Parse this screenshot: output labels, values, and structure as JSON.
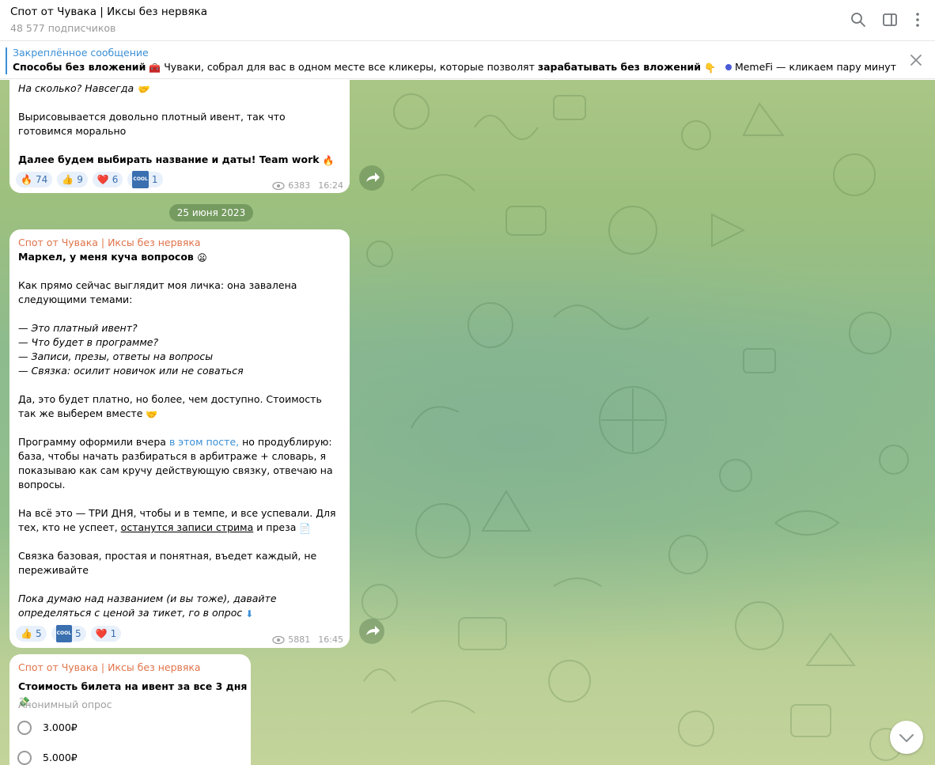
{
  "header": {
    "title": "Спот от Чувака | Иксы без нервяка",
    "subscribers": "48 577 подписчиков"
  },
  "pinned": {
    "label": "Закреплённое сообщение",
    "bold": "Способы без вложений",
    "emoji1": "🧰",
    "text": " Чуваки, собрал для вас в одном месте все кликеры, которые позволят ",
    "bold2": "зарабатывать без вложений",
    "emoji2": "👇",
    "tail": "MemeFi — кликаем пару минут в день..."
  },
  "message1": {
    "line1": "На сколько? Навсегда",
    "line1_emoji": "🤝",
    "line2": "Вырисовывается довольно плотный ивент, так что готовимся морально",
    "line3": "Далее будем выбирать название и даты! Team work",
    "line3_emoji": "🔥",
    "reactions": [
      {
        "emoji": "🔥",
        "count": "74"
      },
      {
        "emoji": "👍",
        "count": "9"
      },
      {
        "emoji": "❤️",
        "count": "6"
      },
      {
        "emoji": "COOL",
        "count": "1"
      }
    ],
    "views": "6383",
    "time": "16:24"
  },
  "date_separator": "25 июня 2023",
  "message2": {
    "author": "Спот от Чувака | Иксы без нервяка",
    "heading": "Маркел, у меня куча вопросов",
    "heading_emoji": "😦",
    "p1": "Как прямо сейчас выглядит моя личка: она завалена следующими темами:",
    "list": [
      "Это платный ивент?",
      "Что будет в программе?",
      "Записи, презы, ответы на вопросы",
      "Связка: осилит новичок или не соваться"
    ],
    "dash": "— ",
    "p2": "Да, это будет платно, но более, чем доступно. Стоимость так же выберем вместе",
    "p2_emoji": "🤝",
    "p3_start": "Программу оформили вчера ",
    "p3_link": "в этом посте,",
    "p3_rest": " но продублирую: база, чтобы начать разбираться в арбитраже + словарь, я показываю как сам кручу действующую связку, отвечаю на вопросы.",
    "p4_start": "На всё это — ТРИ ДНЯ, чтобы и в темпе, и все успевали. Для тех, кто не успеет, ",
    "p4_underline": "останутся записи стрима",
    "p4_end": " и преза",
    "p4_emoji": "📄",
    "p5": "Связка базовая, простая и понятная, въедет каждый, не переживайте",
    "p6": "Пока думаю над названием (и вы тоже), давайте определяться с ценой за тикет, го в опрос",
    "p6_emoji": "⬇",
    "reactions": [
      {
        "emoji": "👍",
        "count": "5"
      },
      {
        "emoji": "COOL",
        "count": "5"
      },
      {
        "emoji": "❤️",
        "count": "1"
      }
    ],
    "views": "5881",
    "time": "16:45"
  },
  "message3": {
    "author": "Спот от Чувака | Иксы без нервяка",
    "question": "Стоимость билета на ивент за все 3 дня",
    "question_emoji": "💸",
    "poll_type": "Анонимный опрос",
    "options": [
      "3.000₽",
      "5.000₽"
    ]
  },
  "colors": {
    "accent": "#3a8fd6",
    "author": "#e0744b",
    "reaction_bg": "#e8f0fb",
    "reaction_text": "#3a6fb0"
  }
}
